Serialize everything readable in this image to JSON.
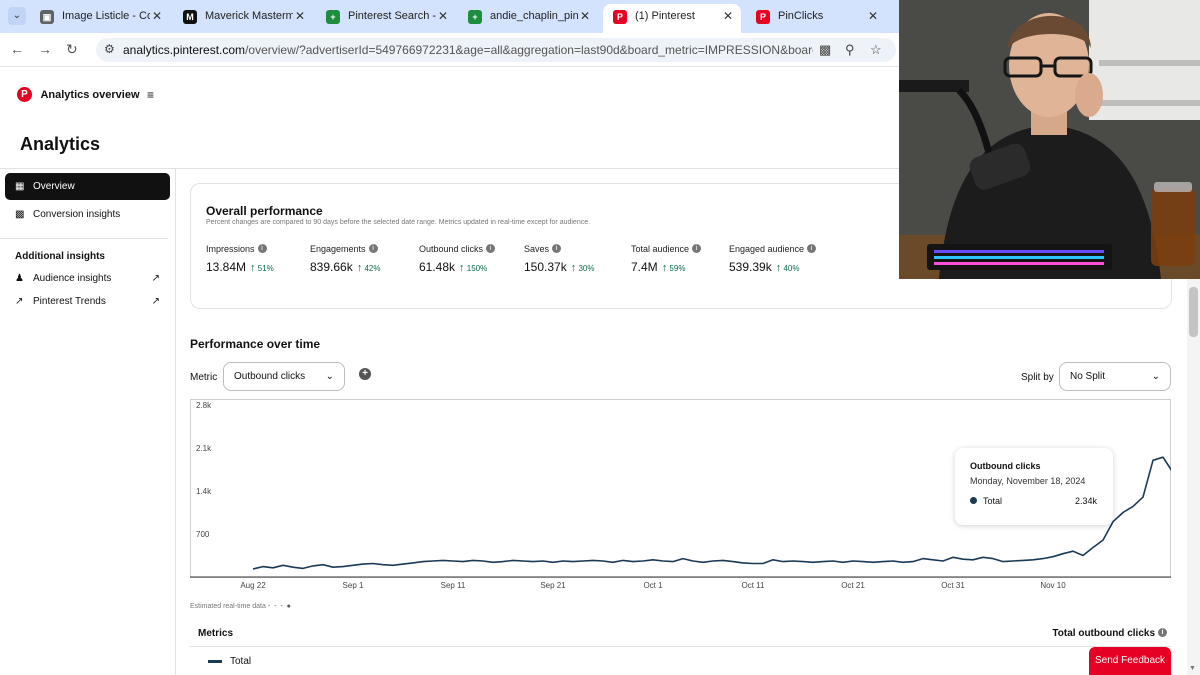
{
  "browser": {
    "tabs": [
      {
        "label": "Image Listicle - Cont",
        "favicon_color": "#5f6368",
        "favicon_glyph": "▣"
      },
      {
        "label": "Maverick Mastermind",
        "favicon_color": "#111111",
        "favicon_glyph": "M"
      },
      {
        "label": "Pinterest Search - ch",
        "favicon_color": "#1e8e3e",
        "favicon_glyph": "+"
      },
      {
        "label": "andie_chaplin_pins_d",
        "favicon_color": "#1e8e3e",
        "favicon_glyph": "+"
      },
      {
        "label": "(1) Pinterest",
        "favicon_color": "#e60023",
        "favicon_glyph": "P"
      },
      {
        "label": "PinClicks",
        "favicon_color": "#e60023",
        "favicon_glyph": "P"
      }
    ],
    "url_host": "analytics.pinterest.com",
    "url_path": "/overview/?advertiserId=549766972231&age=all&aggregation=last90d&board_metric=IMPRESSION&board_id=&cla..."
  },
  "header": {
    "brand_title": "Analytics overview",
    "page_title": "Analytics"
  },
  "sidebar": {
    "items": [
      {
        "label": "Overview",
        "icon": "grid-icon"
      },
      {
        "label": "Conversion insights",
        "icon": "chart-icon"
      }
    ],
    "section_title": "Additional insights",
    "extra_items": [
      {
        "label": "Audience insights",
        "icon": "person-icon"
      },
      {
        "label": "Pinterest Trends",
        "icon": "trend-icon"
      }
    ]
  },
  "overall": {
    "title": "Overall performance",
    "subtitle": "Percent changes are compared to 90 days before the selected date range. Metrics updated in real-time except for audience.",
    "kpis": [
      {
        "label": "Impressions",
        "value": "13.84M",
        "change": "51%"
      },
      {
        "label": "Engagements",
        "value": "839.66k",
        "change": "42%"
      },
      {
        "label": "Outbound clicks",
        "value": "61.48k",
        "change": "150%"
      },
      {
        "label": "Saves",
        "value": "150.37k",
        "change": "30%"
      },
      {
        "label": "Total audience",
        "value": "7.4M",
        "change": "59%"
      },
      {
        "label": "Engaged audience",
        "value": "539.39k",
        "change": "40%"
      }
    ]
  },
  "performance": {
    "title": "Performance over time",
    "metric_label": "Metric",
    "metric_value": "Outbound clicks",
    "split_label": "Split by",
    "split_value": "No Split",
    "estimated_note": "Estimated real-time data",
    "tooltip": {
      "title": "Outbound clicks",
      "date": "Monday, November 18, 2024",
      "series": "Total",
      "value": "2.34k"
    }
  },
  "metrics_table": {
    "left_header": "Metrics",
    "right_header": "Total outbound clicks",
    "row_label": "Total"
  },
  "feedback_label": "Send Feedback",
  "colors": {
    "accent": "#e60023",
    "series": "#1b3a57",
    "positive": "#0a6b4f"
  },
  "chart_data": {
    "type": "line",
    "ylim": [
      0,
      2800
    ],
    "yticks": [
      700,
      1400,
      2100,
      2800
    ],
    "ytick_labels": [
      "700",
      "1.4k",
      "2.1k",
      "2.8k"
    ],
    "xtick_labels": [
      "Aug 22",
      "Sep 1",
      "Sep 11",
      "Sep 21",
      "Oct 1",
      "Oct 11",
      "Oct 21",
      "Oct 31",
      "Nov 10"
    ],
    "start_label": "Aug 22",
    "series": [
      {
        "name": "Total",
        "values": [
          130,
          170,
          150,
          190,
          160,
          140,
          180,
          200,
          160,
          170,
          190,
          210,
          220,
          200,
          190,
          210,
          230,
          250,
          260,
          270,
          260,
          250,
          270,
          260,
          240,
          250,
          270,
          260,
          250,
          260,
          240,
          260,
          250,
          260,
          270,
          260,
          240,
          270,
          250,
          260,
          280,
          260,
          250,
          300,
          260,
          240,
          260,
          270,
          250,
          230,
          220,
          220,
          280,
          250,
          260,
          250,
          240,
          250,
          260,
          240,
          260,
          250,
          240,
          250,
          260,
          240,
          250,
          300,
          280,
          260,
          320,
          290,
          280,
          320,
          300,
          250,
          260,
          270,
          280,
          300,
          330,
          380,
          420,
          350,
          480,
          600,
          900,
          1050,
          1150,
          1300,
          1900,
          1950,
          1700,
          1750,
          1400,
          1150,
          1800,
          1700,
          1600,
          2300,
          2050,
          2100,
          1950,
          1700,
          1600,
          1500,
          1650,
          1500,
          1400,
          1700,
          1800,
          1550,
          1400,
          1300,
          1750,
          2700,
          2500,
          2340,
          2340
        ]
      }
    ],
    "hover_index": 117
  }
}
